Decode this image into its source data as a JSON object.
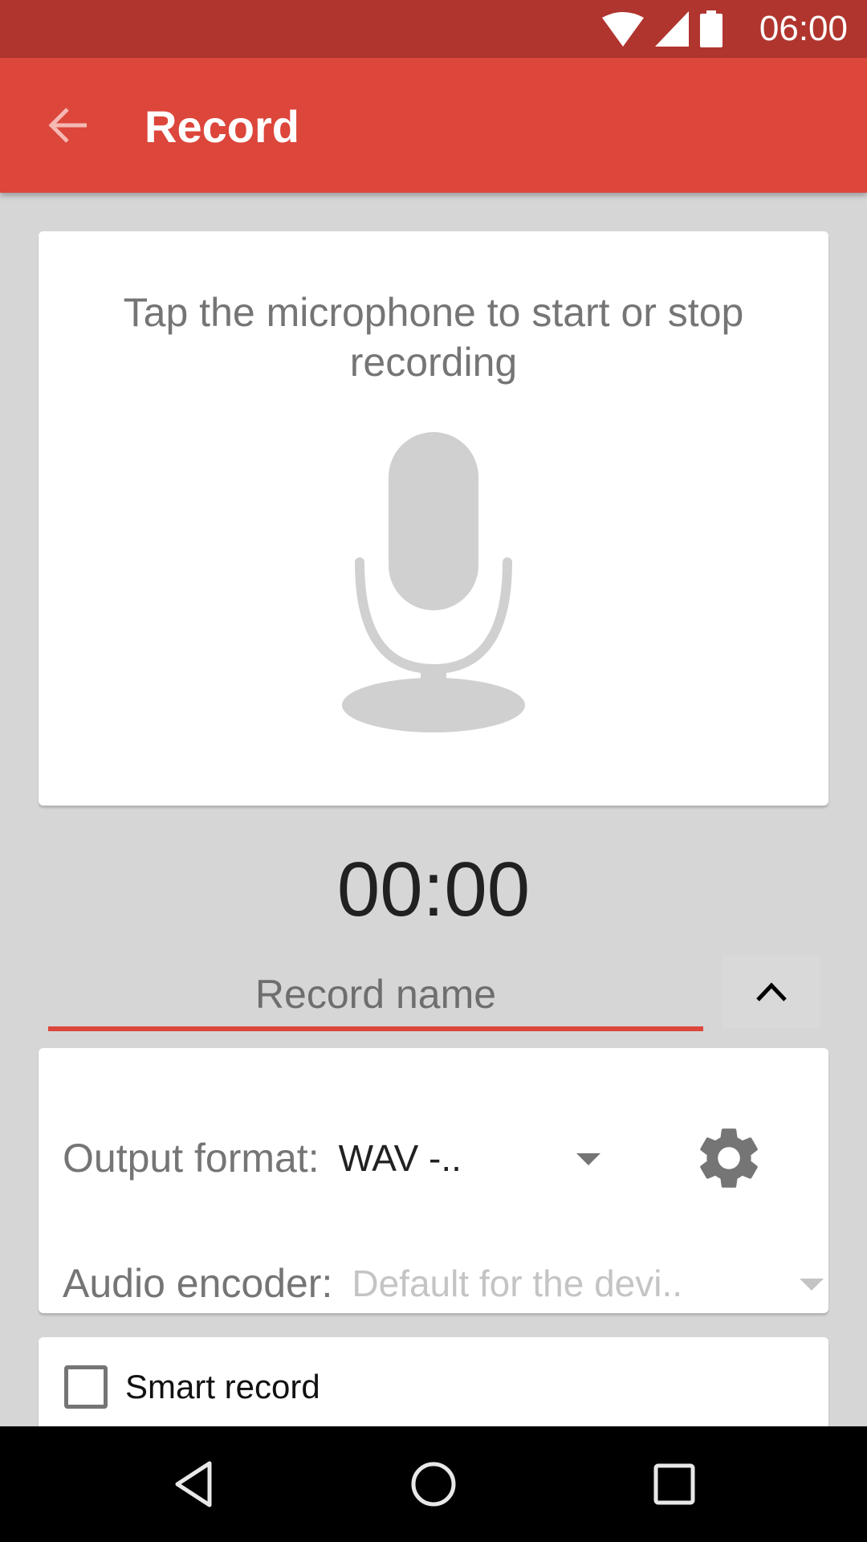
{
  "status_bar": {
    "time": "06:00",
    "icons": [
      "wifi-icon",
      "cell-signal-icon",
      "battery-icon"
    ]
  },
  "app_bar": {
    "title": "Record",
    "back_icon": "arrow-back-icon"
  },
  "recorder": {
    "hint": "Tap the microphone to start or stop recording",
    "mic_icon": "microphone-icon",
    "timer": "00:00"
  },
  "record_name": {
    "value": "",
    "placeholder": "Record name",
    "collapse_icon": "chevron-up-icon"
  },
  "settings": {
    "output_format_label": "Output format:",
    "output_format_value": "WAV -..",
    "audio_encoder_label": "Audio encoder:",
    "audio_encoder_value": "Default for the devi..",
    "settings_icon": "gear-icon"
  },
  "smart_record": {
    "label": "Smart record",
    "checked": false
  },
  "nav_bar": {
    "buttons": [
      "back",
      "home",
      "recents"
    ]
  },
  "colors": {
    "status_bar": "#b0352e",
    "primary": "#dc463b",
    "background": "#d6d6d6"
  }
}
